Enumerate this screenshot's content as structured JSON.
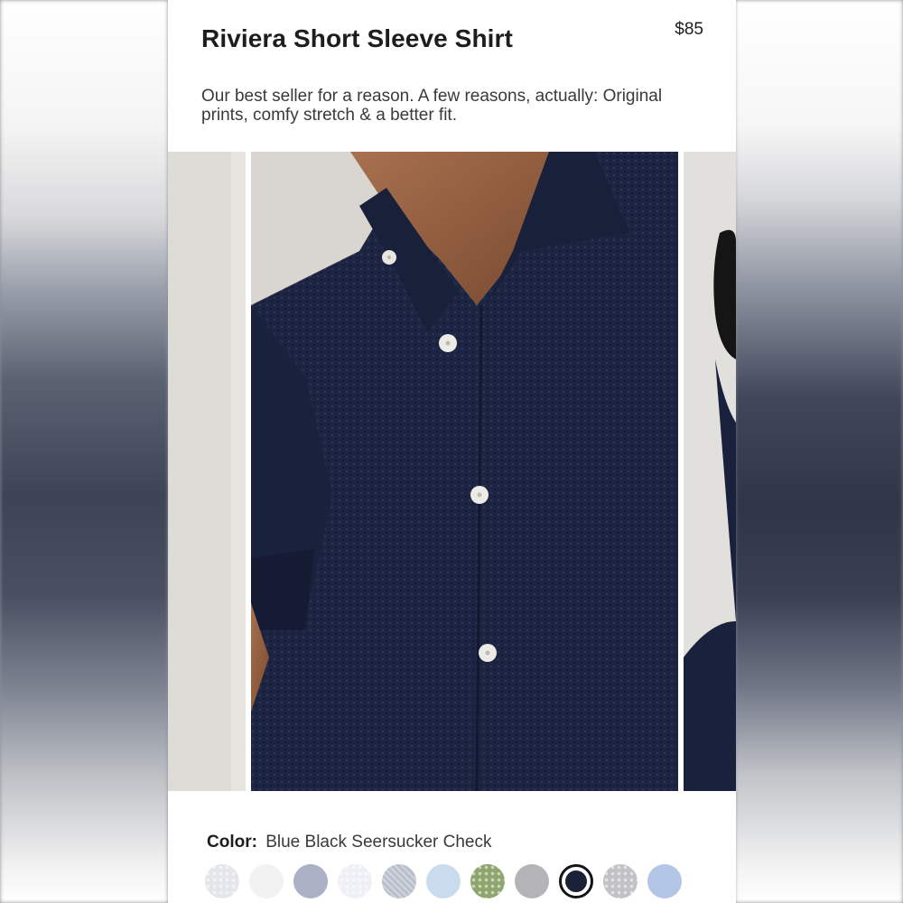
{
  "product": {
    "title": "Riviera Short Sleeve Shirt",
    "price": "$85",
    "description": "Our best seller for a reason. A few reasons, actually: Original prints, comfy stretch & a better fit."
  },
  "color_selector": {
    "label": "Color:",
    "selected_value": "Blue Black Seersucker Check",
    "swatches": [
      {
        "color": "#e4e6ec",
        "pattern": "dotted"
      },
      {
        "color": "#f2f2f2",
        "pattern": "solid"
      },
      {
        "color": "#aab1c4",
        "pattern": "solid"
      },
      {
        "color": "#eef0f5",
        "pattern": "dotted"
      },
      {
        "color": "#b9bfcb",
        "pattern": "check"
      },
      {
        "color": "#c9dced",
        "pattern": "solid"
      },
      {
        "color": "#8ea56e",
        "pattern": "dotted"
      },
      {
        "color": "#b4b4b8",
        "pattern": "solid"
      },
      {
        "color": "#1b2238",
        "pattern": "solid",
        "selected": true
      },
      {
        "color": "#c2c2c6",
        "pattern": "dotted"
      },
      {
        "color": "#b3c6e6",
        "pattern": "solid"
      }
    ]
  },
  "gallery": {
    "main_image_icon": "navy-seersucker-shirt-photo",
    "prev_image_icon": "model-photo-partial",
    "next_image_icon": "model-photo-partial"
  }
}
